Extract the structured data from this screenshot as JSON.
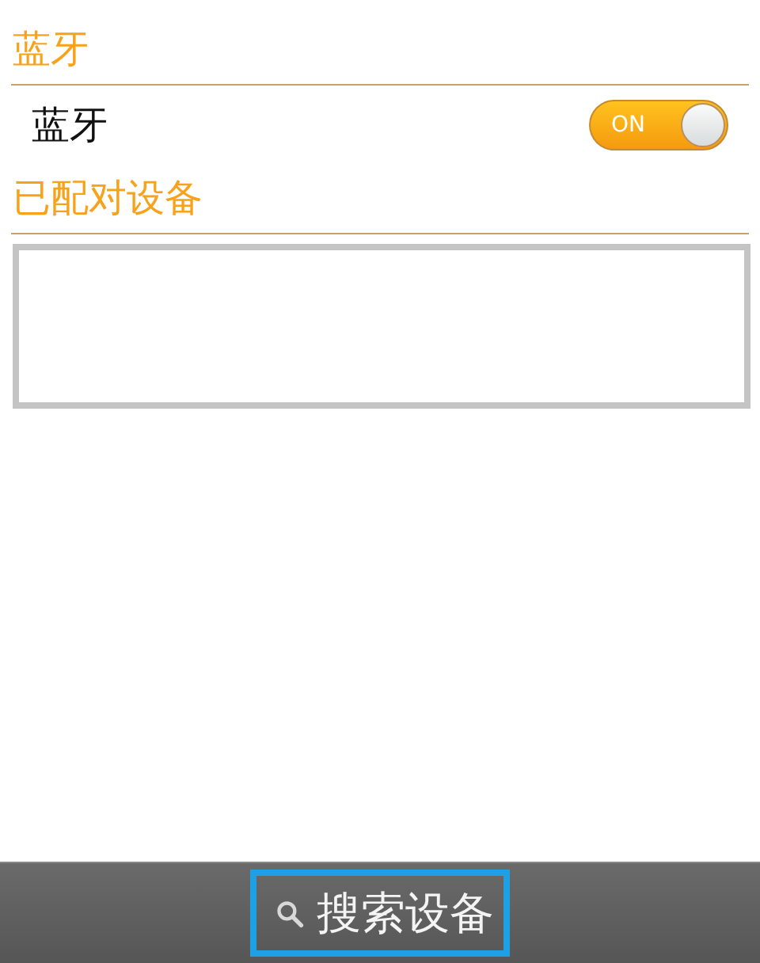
{
  "bluetooth_section": {
    "title": "蓝牙"
  },
  "bluetooth_toggle": {
    "label": "蓝牙",
    "on": true,
    "switch_text": "ON"
  },
  "paired_section": {
    "title": "已配对设备"
  },
  "bottom_bar": {
    "search_button": {
      "label": "搜索设备",
      "selected": true
    }
  }
}
